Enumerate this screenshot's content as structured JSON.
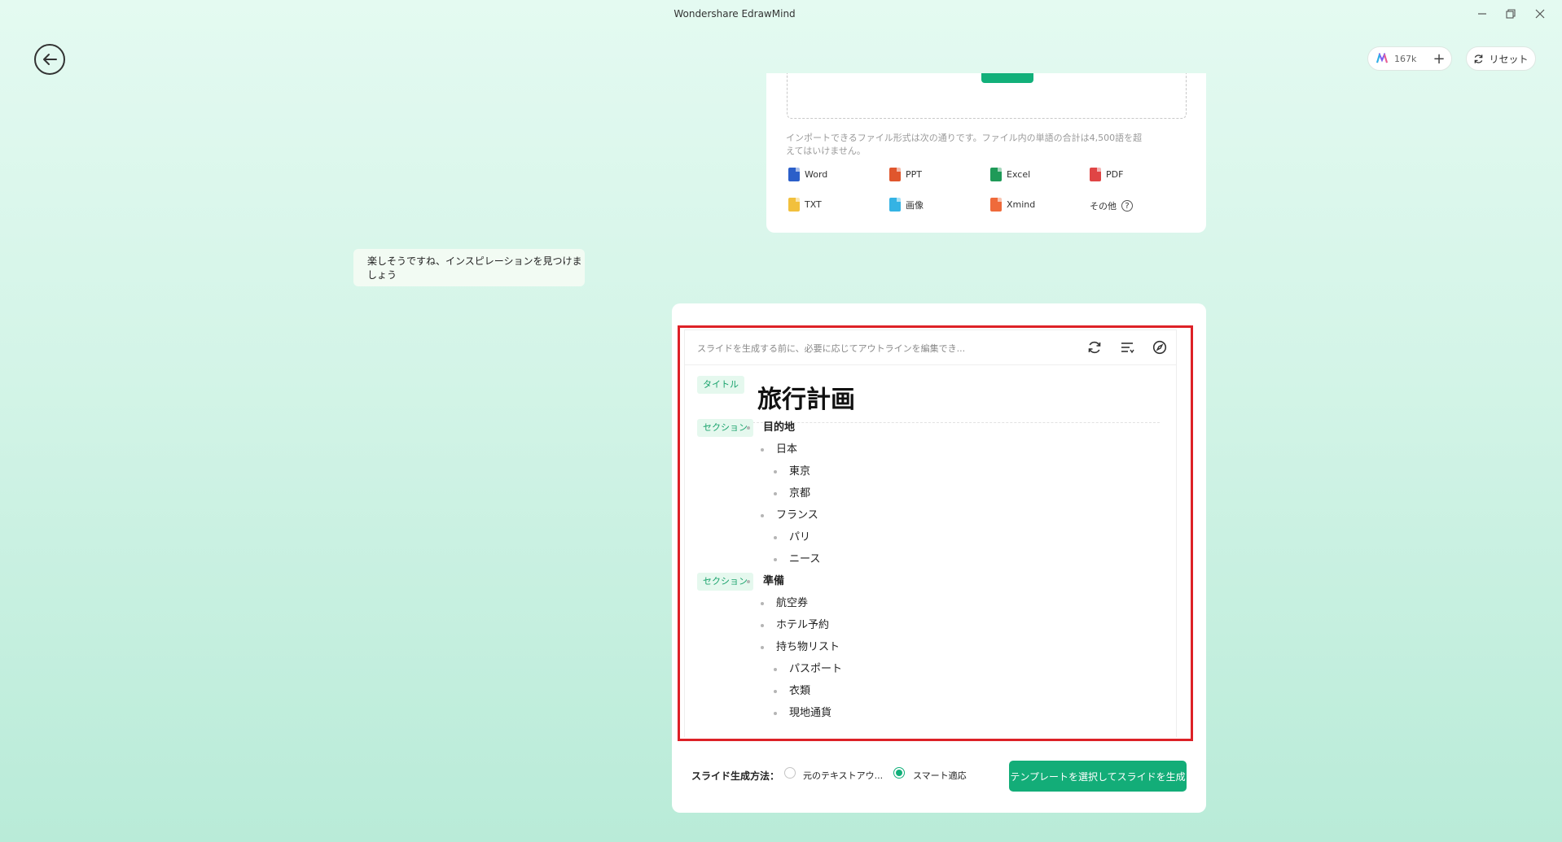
{
  "window": {
    "title": "Wondershare EdrawMind",
    "minimize_icon": "minimize-icon",
    "restore_icon": "restore-icon",
    "close_icon": "close-icon"
  },
  "header": {
    "credits": "167k",
    "add_credits_icon": "plus-icon",
    "reset_label": "リセット"
  },
  "upload": {
    "note": "インポートできるファイル形式は次の通りです。ファイル内の単語の合計は4,500語を超えてはいけません。",
    "file_types": [
      {
        "label": "Word",
        "color": "#2b5fc9"
      },
      {
        "label": "PPT",
        "color": "#e0562d"
      },
      {
        "label": "Excel",
        "color": "#1f9a58"
      },
      {
        "label": "PDF",
        "color": "#e04545"
      },
      {
        "label": "TXT",
        "color": "#f2c03d"
      },
      {
        "label": "画像",
        "color": "#34b3e4"
      },
      {
        "label": "Xmind",
        "color": "#ef6a3b"
      },
      {
        "label": "その他"
      }
    ]
  },
  "chat": {
    "message": "楽しそうですね、インスピレーションを見つけましょう"
  },
  "outline": {
    "hint": "スライドを生成する前に、必要に応じてアウトラインを編集でき...",
    "title_tag": "タイトル",
    "title": "旅行計画",
    "section_tag": "セクション",
    "nodes": [
      {
        "text": "目的地",
        "level": 0
      },
      {
        "text": "日本",
        "level": 1
      },
      {
        "text": "東京",
        "level": 2
      },
      {
        "text": "京都",
        "level": 2
      },
      {
        "text": "フランス",
        "level": 1
      },
      {
        "text": "パリ",
        "level": 2
      },
      {
        "text": "ニース",
        "level": 2
      },
      {
        "text": "準備",
        "level": 0
      },
      {
        "text": "航空券",
        "level": 1
      },
      {
        "text": "ホテル予約",
        "level": 1
      },
      {
        "text": "持ち物リスト",
        "level": 1
      },
      {
        "text": "パスポート",
        "level": 2
      },
      {
        "text": "衣類",
        "level": 2
      },
      {
        "text": "現地通貨",
        "level": 2
      }
    ]
  },
  "generation": {
    "method_label": "スライド生成方法：",
    "options": [
      {
        "label": "元のテキストアウ...",
        "selected": false
      },
      {
        "label": "スマート適応",
        "selected": true
      }
    ],
    "generate_button": "テンプレートを選択してスライドを生成"
  },
  "colors": {
    "accent": "#13ad78",
    "highlight_border": "#dd2127"
  }
}
